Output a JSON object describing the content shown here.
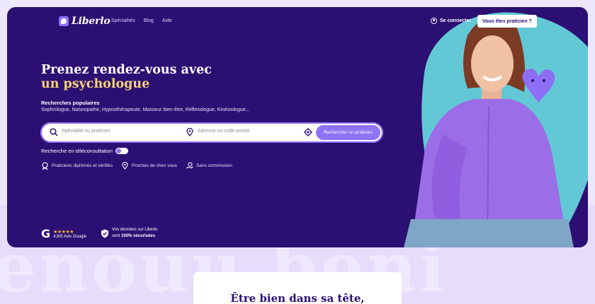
{
  "brand": {
    "name": "Liberlo"
  },
  "nav": {
    "items": [
      "Spécialités",
      "Blog",
      "Aide"
    ]
  },
  "header": {
    "login_label": "Se connecter",
    "pro_button": "Vous êtes praticien ?"
  },
  "hero": {
    "title_line1": "Prenez rendez-vous avec",
    "title_line2": "un psychologue",
    "popular_title": "Recherches populaires",
    "popular_list": "Sophrologue, Naturopathe, Hypnothérapeute, Masseur bien-être, Réflexologue, Kinésiologue..."
  },
  "search": {
    "specialty_placeholder": "Spécialité ou praticien",
    "address_placeholder": "Adresse ou code postal",
    "submit_label": "Rechercher un praticien"
  },
  "teleconsultation": {
    "label": "Recherche en téléconsultation"
  },
  "features": [
    "Praticiens diplômés et vérifiés",
    "Proches de chez vous",
    "Sans commission"
  ],
  "google": {
    "logo": "G",
    "stars": "★★★★★",
    "rating_text": "4,8/5 Avis Google"
  },
  "security": {
    "line1": "Vos données sur Liberlo",
    "line2_prefix": "sont ",
    "line2_bold": "100% sécurisées"
  },
  "watermark": "enouu beni",
  "card": {
    "title": "Être bien dans sa tête,"
  },
  "colors": {
    "hero_bg": "#2c0f73",
    "accent": "#8f73f5",
    "title_accent": "#f7d37a",
    "teal": "#63c8d6"
  }
}
